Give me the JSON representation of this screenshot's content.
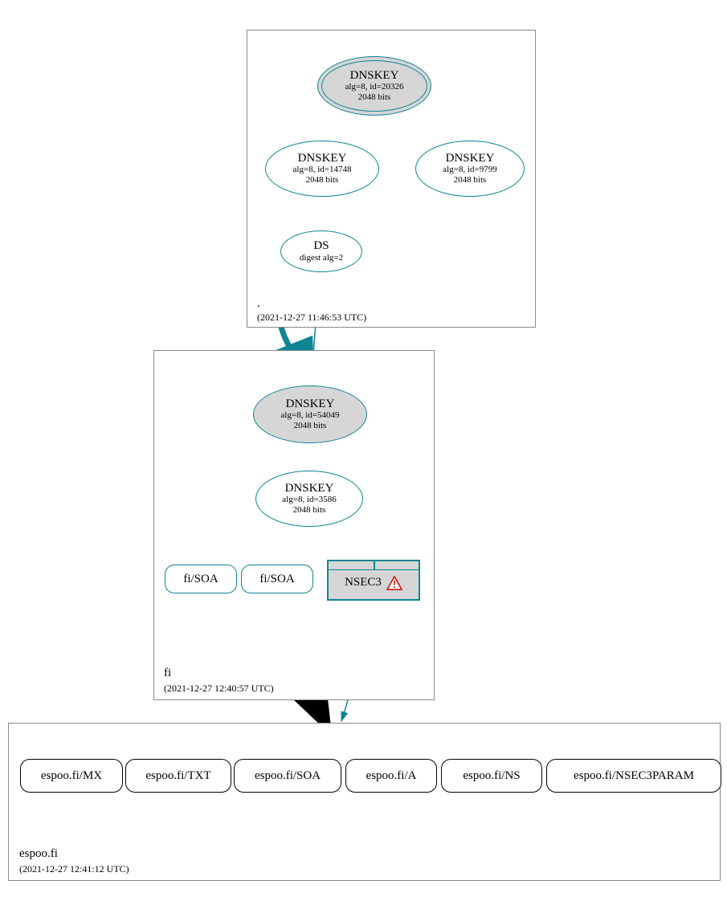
{
  "colors": {
    "teal": "#0e8494",
    "black": "#000000",
    "red": "#cc1a1a",
    "grey": "#d6d6d6"
  },
  "zones": {
    "root": {
      "name": ".",
      "timestamp": "(2021-12-27 11:46:53 UTC)",
      "nodes": {
        "ksk": {
          "title": "DNSKEY",
          "line2": "alg=8, id=20326",
          "line3": "2048 bits"
        },
        "zsk1": {
          "title": "DNSKEY",
          "line2": "alg=8, id=14748",
          "line3": "2048 bits"
        },
        "zsk2": {
          "title": "DNSKEY",
          "line2": "alg=8, id=9799",
          "line3": "2048 bits"
        },
        "ds": {
          "title": "DS",
          "line2": "digest alg=2"
        }
      }
    },
    "fi": {
      "name": "fi",
      "timestamp": "(2021-12-27 12:40:57 UTC)",
      "nodes": {
        "ksk": {
          "title": "DNSKEY",
          "line2": "alg=8, id=54049",
          "line3": "2048 bits"
        },
        "zsk": {
          "title": "DNSKEY",
          "line2": "alg=8, id=3586",
          "line3": "2048 bits"
        },
        "soa1": {
          "label": "fi/SOA"
        },
        "soa2": {
          "label": "fi/SOA"
        },
        "nsec3": {
          "label": "NSEC3"
        }
      }
    },
    "espoo": {
      "name": "espoo.fi",
      "timestamp": "(2021-12-27 12:41:12 UTC)",
      "records": {
        "mx": "espoo.fi/MX",
        "txt": "espoo.fi/TXT",
        "soa": "espoo.fi/SOA",
        "a": "espoo.fi/A",
        "ns": "espoo.fi/NS",
        "nsec3param": "espoo.fi/NSEC3PARAM"
      }
    }
  }
}
